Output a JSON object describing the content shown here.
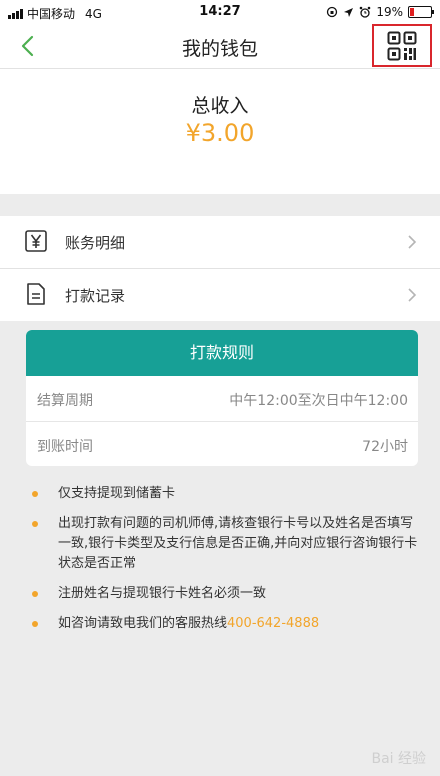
{
  "status_bar": {
    "carrier": "中国移动",
    "network": "4G",
    "time": "14:27",
    "battery_percent": "19%",
    "battery_level": 0.19
  },
  "nav": {
    "title": "我的钱包"
  },
  "income": {
    "label": "总收入",
    "value": "¥3.00"
  },
  "menu": {
    "items": [
      {
        "label": "账务明细",
        "icon": "yen-ledger-icon"
      },
      {
        "label": "打款记录",
        "icon": "document-icon"
      }
    ]
  },
  "rules": {
    "header": "打款规则",
    "rows": [
      {
        "key": "结算周期",
        "value": "中午12:00至次日中午12:00"
      },
      {
        "key": "到账时间",
        "value": "72小时"
      }
    ]
  },
  "notes": [
    {
      "text": "仅支持提现到储蓄卡"
    },
    {
      "text": "出现打款有问题的司机师傅,请核查银行卡号以及姓名是否填写一致,银行卡类型及支行信息是否正确,并向对应银行咨询银行卡状态是否正常"
    },
    {
      "text": "注册姓名与提现银行卡姓名必须一致"
    },
    {
      "text": "如咨询请致电我们的客服热线",
      "phone": "400-642-4888"
    }
  ],
  "watermark": "Bai 经验",
  "colors": {
    "accent_teal": "#17a096",
    "accent_orange": "#f2a52b",
    "back_green": "#4caf50",
    "highlight_red": "#d9262c"
  }
}
